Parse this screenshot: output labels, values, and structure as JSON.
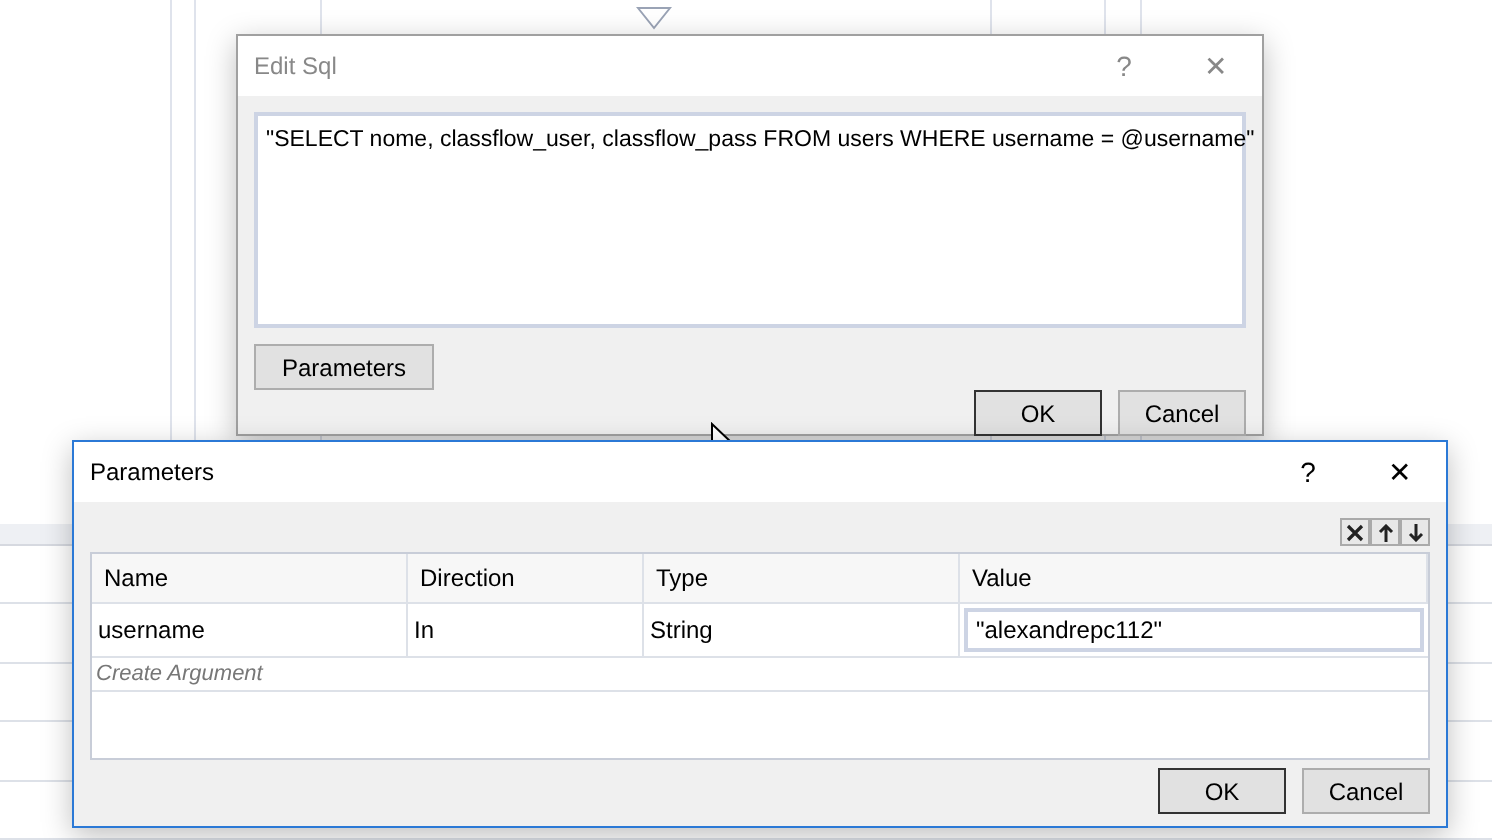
{
  "edit_sql_dialog": {
    "title": "Edit Sql",
    "help": "?",
    "close": "✕",
    "query": "\"SELECT nome, classflow_user, classflow_pass FROM users WHERE username = @username\"",
    "parameters_button": "Parameters",
    "ok": "OK",
    "cancel": "Cancel"
  },
  "parameters_dialog": {
    "title": "Parameters",
    "help": "?",
    "close": "✕",
    "columns": [
      "Name",
      "Direction",
      "Type",
      "Value"
    ],
    "rows": [
      {
        "cells": [
          "username",
          "In",
          "String"
        ],
        "value": "\"alexandrepc112\""
      }
    ],
    "create_argument": "Create Argument",
    "ok": "OK",
    "cancel": "Cancel"
  }
}
